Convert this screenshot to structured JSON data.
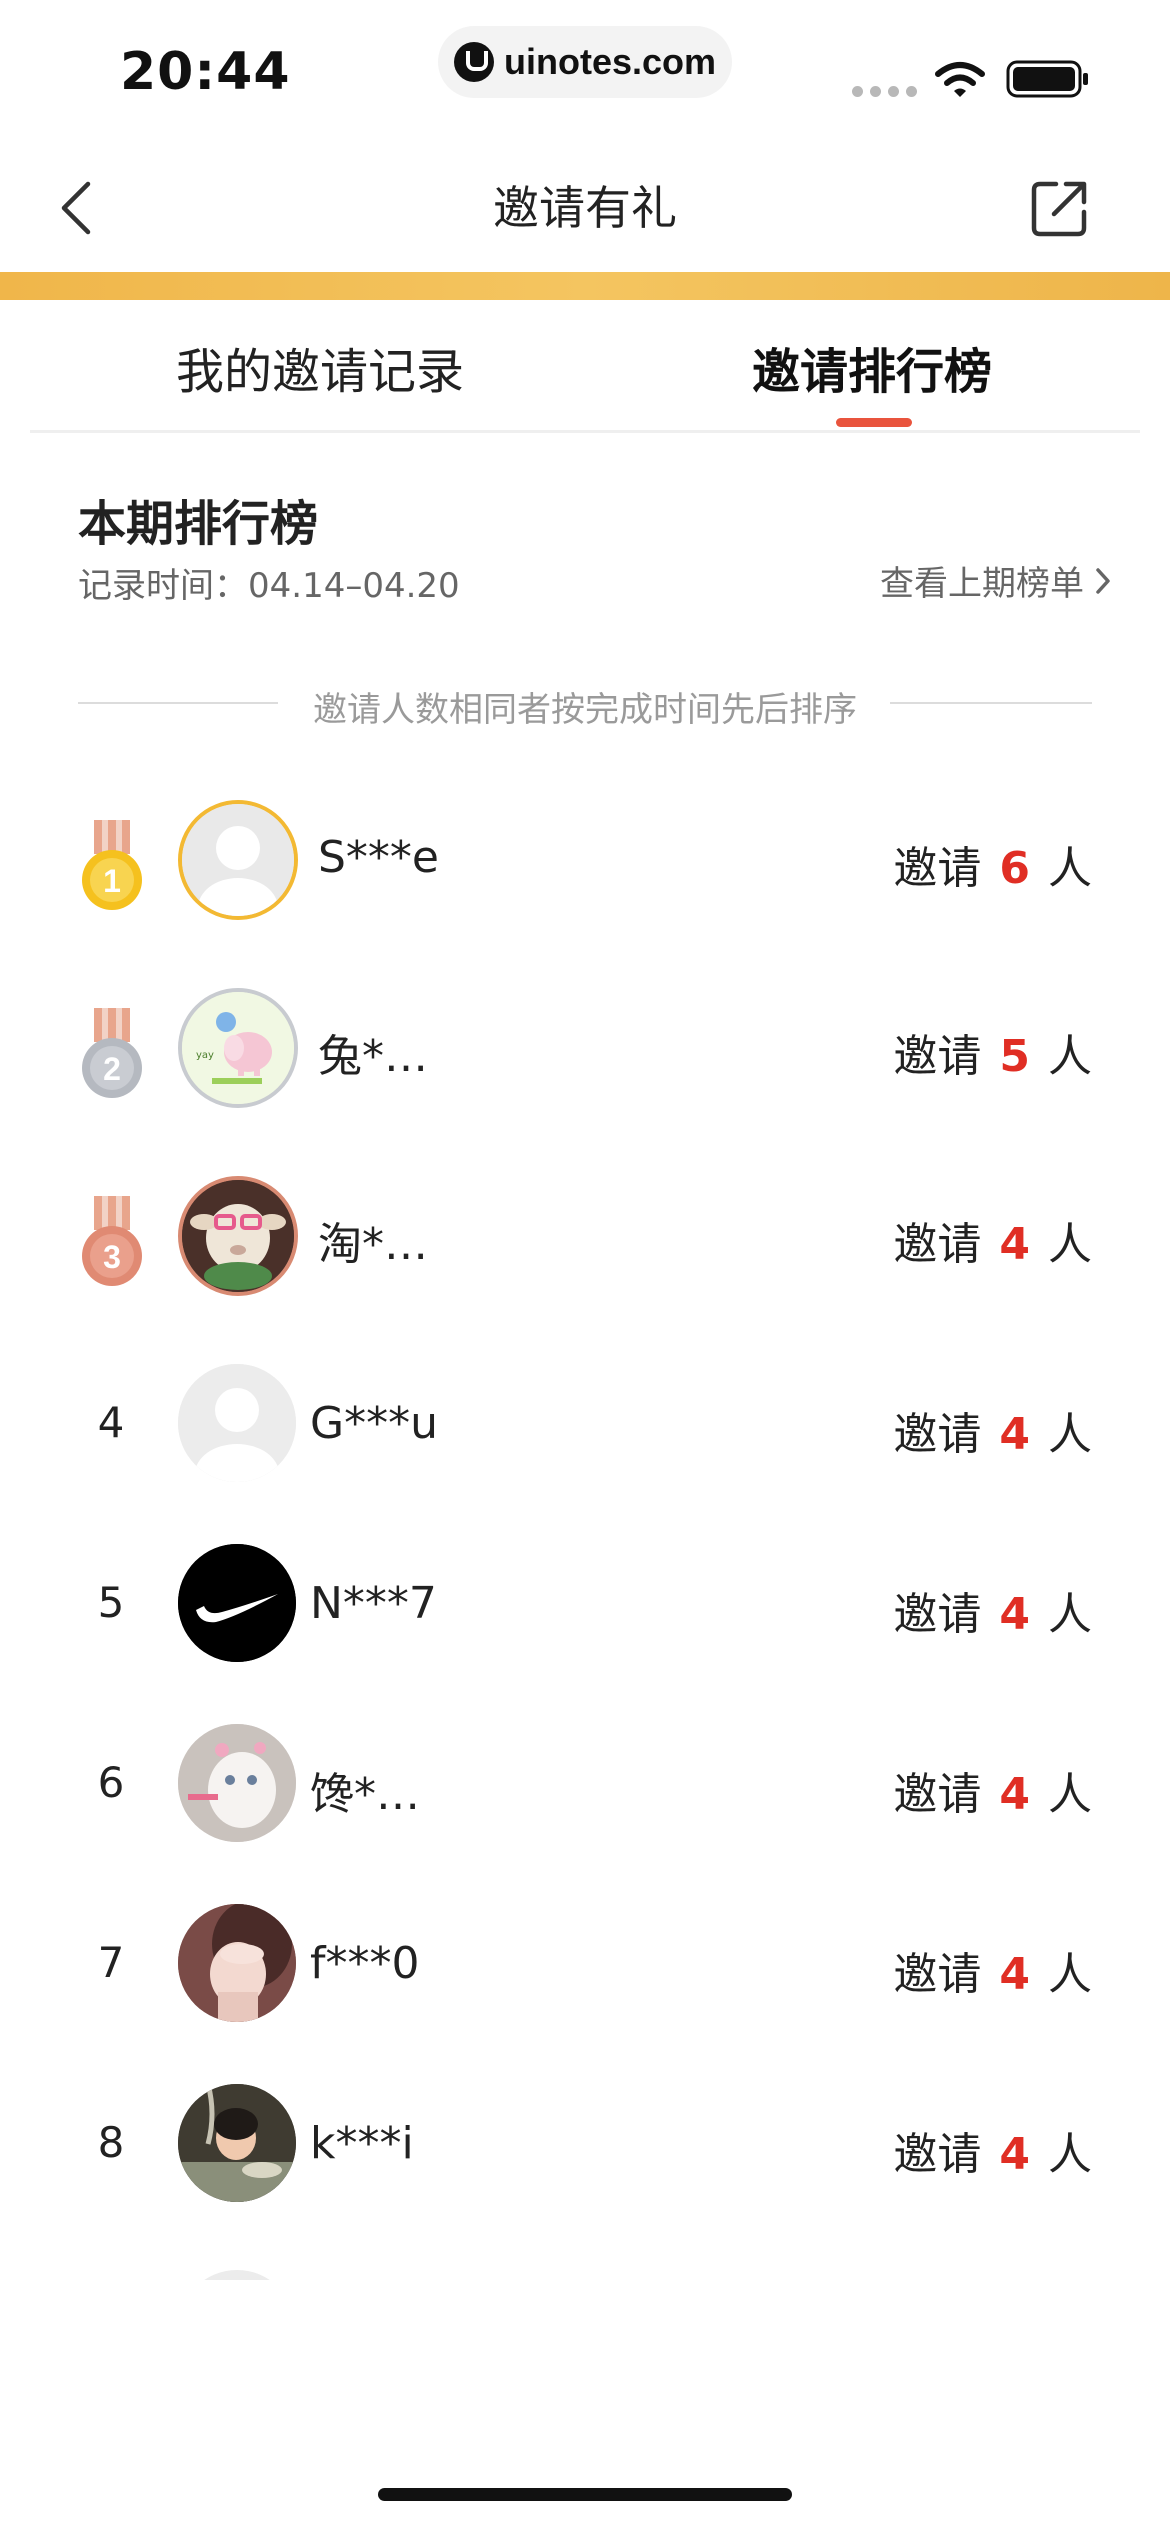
{
  "status_bar": {
    "time": "20:44",
    "url": "uinotes.com"
  },
  "header": {
    "title": "邀请有礼"
  },
  "tabs": [
    {
      "label": "我的邀请记录",
      "active": false
    },
    {
      "label": "邀请排行榜",
      "active": true
    }
  ],
  "section": {
    "title": "本期排行榜",
    "record_time": "记录时间：04.14–04.20",
    "view_last": "查看上期榜单",
    "rule": "邀请人数相同者按完成时间先后排序"
  },
  "invite_prefix": "邀请",
  "invite_suffix": "人",
  "colors": {
    "accent": "#e9543d",
    "gold": "#f0b64a",
    "count_red": "#e02e24"
  },
  "ranking": [
    {
      "rank": "1",
      "name": "S***e",
      "count": "6",
      "medal": "gold"
    },
    {
      "rank": "2",
      "name": "兔*…",
      "count": "5",
      "medal": "silver"
    },
    {
      "rank": "3",
      "name": "淘*…",
      "count": "4",
      "medal": "bronze"
    },
    {
      "rank": "4",
      "name": "G***u",
      "count": "4"
    },
    {
      "rank": "5",
      "name": "N***7",
      "count": "4"
    },
    {
      "rank": "6",
      "name": "馋*…",
      "count": "4"
    },
    {
      "rank": "7",
      "name": "f***0",
      "count": "4"
    },
    {
      "rank": "8",
      "name": "k***i",
      "count": "4"
    }
  ]
}
